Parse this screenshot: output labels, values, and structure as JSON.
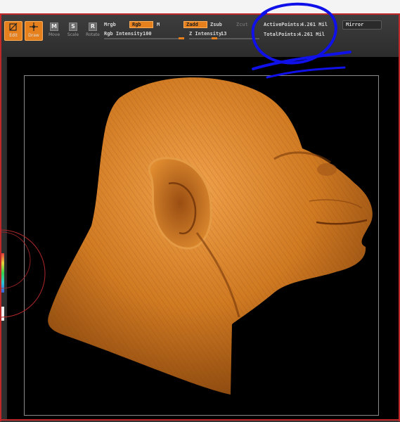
{
  "toolbar": {
    "tools": [
      {
        "icon": "edit-icon",
        "label": "Edit",
        "active": true
      },
      {
        "icon": "draw-icon",
        "label": "Draw",
        "active": true
      },
      {
        "icon": "move-icon",
        "label": "Move",
        "active": false,
        "glyph": "M"
      },
      {
        "icon": "scale-icon",
        "label": "Scale",
        "active": false,
        "glyph": "S"
      },
      {
        "icon": "rotate-icon",
        "label": "Rotate",
        "active": false,
        "glyph": "R"
      }
    ],
    "mrgb_label": "Mrgb",
    "rgb_label": "Rgb",
    "m_label": "M",
    "rgb_intensity_label": "Rgb Intensity",
    "rgb_intensity_value": "100",
    "rgb_intensity_fraction": 1.0,
    "zadd_label": "Zadd",
    "zsub_label": "Zsub",
    "zcut_label": "Zcut",
    "z_intensity_label": "Z Intensity",
    "z_intensity_value": "13",
    "z_intensity_fraction": 0.13,
    "active_points_label": "ActivePoints:",
    "active_points_value": "4.261 Mil",
    "total_points_label": "TotalPoints:",
    "total_points_value": "4.261 Mil",
    "mirror_label": "Mirror"
  },
  "colors": {
    "accent": "#e5801d",
    "toolbar_bg": "#363636",
    "viewport_bg": "#000000",
    "annotation_ink": "#1010e8",
    "frame_red": "#c0282a",
    "model_base": "#c8701a"
  },
  "annotation": {
    "shape": "circle-around-points-counters",
    "color": "#1010e8"
  },
  "viewport": {
    "model": "chimpanzee-head-sculpt",
    "material": "orange-clay"
  }
}
